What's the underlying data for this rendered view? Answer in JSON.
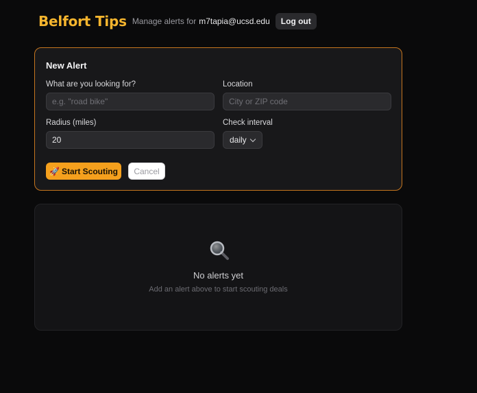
{
  "header": {
    "brand": "Belfort Tips",
    "manage_text": "Manage alerts for",
    "email": "m7tapia@ucsd.edu",
    "logout_label": "Log out"
  },
  "form": {
    "title": "New Alert",
    "query_label": "What are you looking for?",
    "query_placeholder": "e.g. \"road bike\"",
    "location_label": "Location",
    "location_placeholder": "City or ZIP code",
    "radius_label": "Radius (miles)",
    "radius_value": "20",
    "interval_label": "Check interval",
    "interval_value": "daily",
    "start_icon": "🚀",
    "start_label": "Start Scouting",
    "cancel_label": "Cancel"
  },
  "empty_state": {
    "icon": "magnifying-glass-icon",
    "title": "No alerts yet",
    "subtitle": "Add an alert above to start scouting deals"
  },
  "colors": {
    "accent": "#f5a01d",
    "brand": "#f5b52e",
    "card_border": "#c7761f",
    "background": "#0a0a0b"
  }
}
